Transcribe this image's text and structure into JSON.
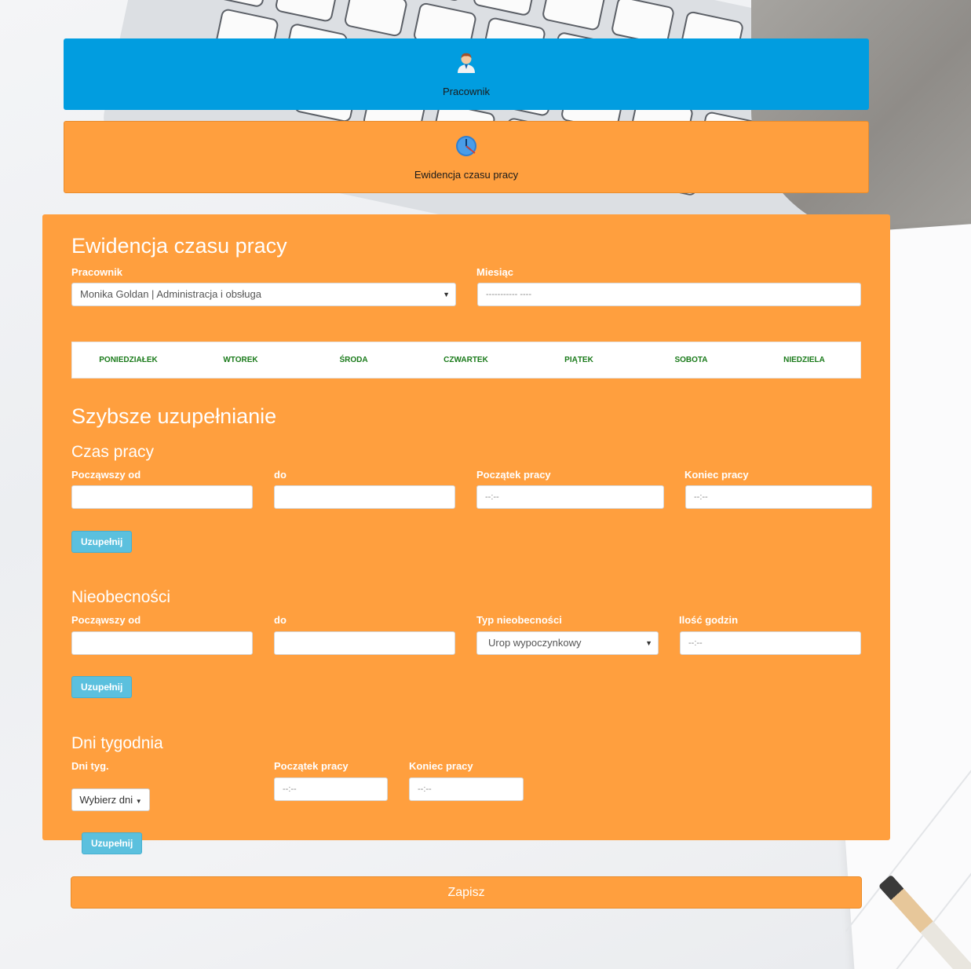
{
  "cards": {
    "employee": {
      "label": "Pracownik",
      "icon": "user-icon"
    },
    "time": {
      "label": "Ewidencja czasu pracy",
      "icon": "clock-icon"
    }
  },
  "form": {
    "title": "Ewidencja czasu pracy",
    "employee_label": "Pracownik",
    "employee_value": "Monika Goldan | Administracja i obsługa",
    "month_label": "Miesiąc",
    "month_value": "----------- ----",
    "days": [
      "PONIEDZIAŁEK",
      "WTOREK",
      "ŚRODA",
      "CZWARTEK",
      "PIĄTEK",
      "SOBOTA",
      "NIEDZIELA"
    ]
  },
  "quick_fill": {
    "title": "Szybsze uzupełnianie",
    "work_time": {
      "title": "Czas pracy",
      "from_label": "Począwszy od",
      "to_label": "do",
      "start_label": "Początek pracy",
      "end_label": "Koniec pracy",
      "start_value": "--:--",
      "end_value": "--:--",
      "button": "Uzupełnij"
    },
    "absence": {
      "title": "Nieobecności",
      "from_label": "Począwszy od",
      "to_label": "do",
      "type_label": "Typ nieobecności",
      "type_value": "Urop wypoczynkowy",
      "hours_label": "Ilość godzin",
      "hours_value": "--:--",
      "button": "Uzupełnij"
    },
    "weekdays": {
      "title": "Dni tygodnia",
      "days_label": "Dni tyg.",
      "days_button": "Wybierz dni",
      "start_label": "Początek pracy",
      "end_label": "Koniec pracy",
      "start_value": "--:--",
      "end_value": "--:--",
      "button": "Uzupełnij"
    }
  },
  "save_button": "Zapisz",
  "colors": {
    "accent_blue": "#019de0",
    "accent_orange": "#ff9f3e",
    "button_info": "#5bc0de",
    "day_text": "#1a7a1a"
  }
}
